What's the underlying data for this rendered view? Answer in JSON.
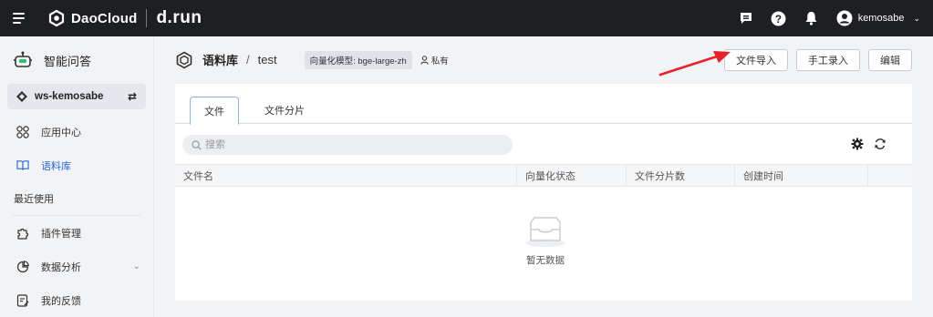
{
  "topbar": {
    "brand_name": "DaoCloud",
    "brand_sub": "d.run",
    "username": "kemosabe"
  },
  "sidebar": {
    "title": "智能问答",
    "workspace": "ws-kemosabe",
    "items": [
      {
        "label": "应用中心",
        "icon": "app-center-icon"
      },
      {
        "label": "语料库",
        "icon": "book-icon",
        "active": true
      }
    ],
    "recent_label": "最近使用",
    "recent_items": [
      {
        "label": "插件管理",
        "icon": "puzzle-icon"
      },
      {
        "label": "数据分析",
        "icon": "chart-icon",
        "expandable": true
      },
      {
        "label": "我的反馈",
        "icon": "feedback-icon"
      }
    ]
  },
  "header": {
    "breadcrumb_main": "语料库",
    "breadcrumb_sep": "/",
    "breadcrumb_sub": "test",
    "vector_model_tag": "向量化模型: bge-large-zh",
    "visibility": "私有",
    "buttons": {
      "import": "文件导入",
      "manual": "手工录入",
      "edit": "编辑"
    }
  },
  "tabs": [
    {
      "label": "文件",
      "active": true
    },
    {
      "label": "文件分片",
      "active": false
    }
  ],
  "search": {
    "placeholder": "搜索"
  },
  "table": {
    "columns": [
      "文件名",
      "向量化状态",
      "文件分片数",
      "创建时间",
      ""
    ],
    "rows": []
  },
  "empty_text": "暂无数据",
  "colors": {
    "topbar_bg": "#1e1f22",
    "accent": "#2a66d4",
    "annotation_arrow": "#e8222a"
  }
}
